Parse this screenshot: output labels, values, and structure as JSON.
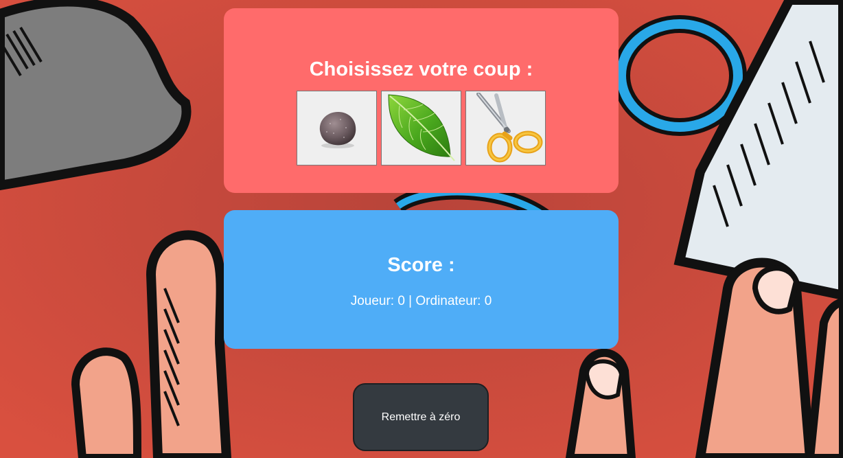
{
  "choose": {
    "title": "Choisissez votre coup :",
    "choices": [
      {
        "name": "rock",
        "icon": "rock-icon"
      },
      {
        "name": "paper",
        "icon": "leaf-icon"
      },
      {
        "name": "scissors",
        "icon": "scissors-icon"
      }
    ]
  },
  "score": {
    "title": "Score :",
    "line": "Joueur: 0 | Ordinateur: 0"
  },
  "reset": {
    "label": "Remettre à zéro"
  },
  "colors": {
    "choose_panel": "#ff6b6b",
    "score_panel": "#4fadf7",
    "reset_button": "#343a40",
    "background": "#c94a3c"
  }
}
